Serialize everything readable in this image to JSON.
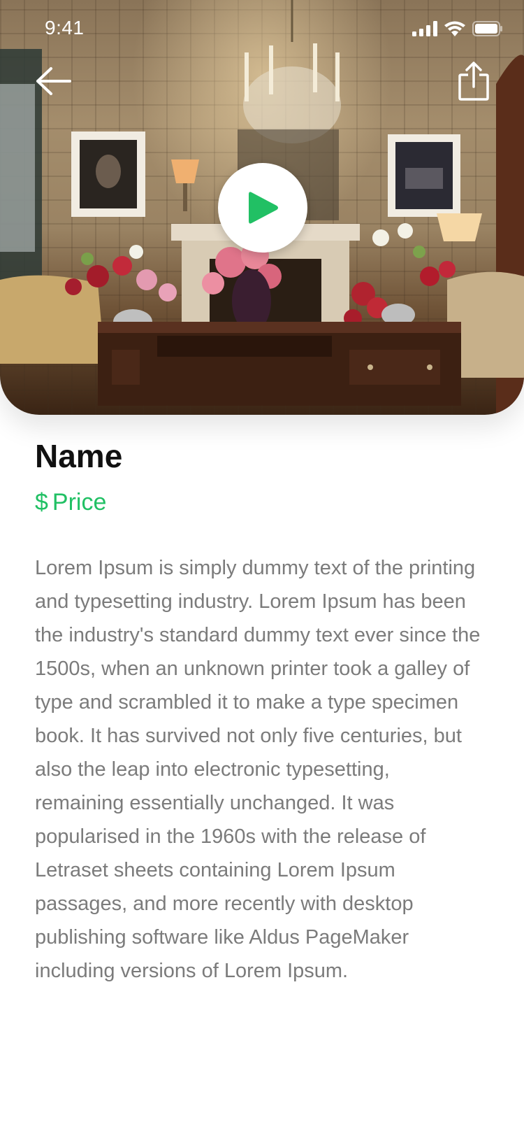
{
  "status_bar": {
    "time": "9:41"
  },
  "hero": {
    "image": "room-photo",
    "back_icon": "arrow-left-icon",
    "share_icon": "share-icon",
    "play_icon": "play-icon"
  },
  "product": {
    "name": "Name",
    "currency": "$",
    "price": "Price",
    "description": "Lorem Ipsum is simply dummy text of the printing and typesetting industry. Lorem Ipsum has been the industry's standard dummy text ever since the 1500s, when an unknown printer took a galley of type and scrambled it to make a type specimen book. It has survived not only five centuries, but also the leap into electronic typesetting, remaining essentially unchanged. It was popularised in the 1960s with the release of Letraset sheets containing Lorem Ipsum passages, and more recently with desktop publishing software like Aldus PageMaker including versions of Lorem Ipsum."
  },
  "colors": {
    "accent": "#21c064",
    "text": "#111111",
    "body_text": "#7b7b7b"
  }
}
